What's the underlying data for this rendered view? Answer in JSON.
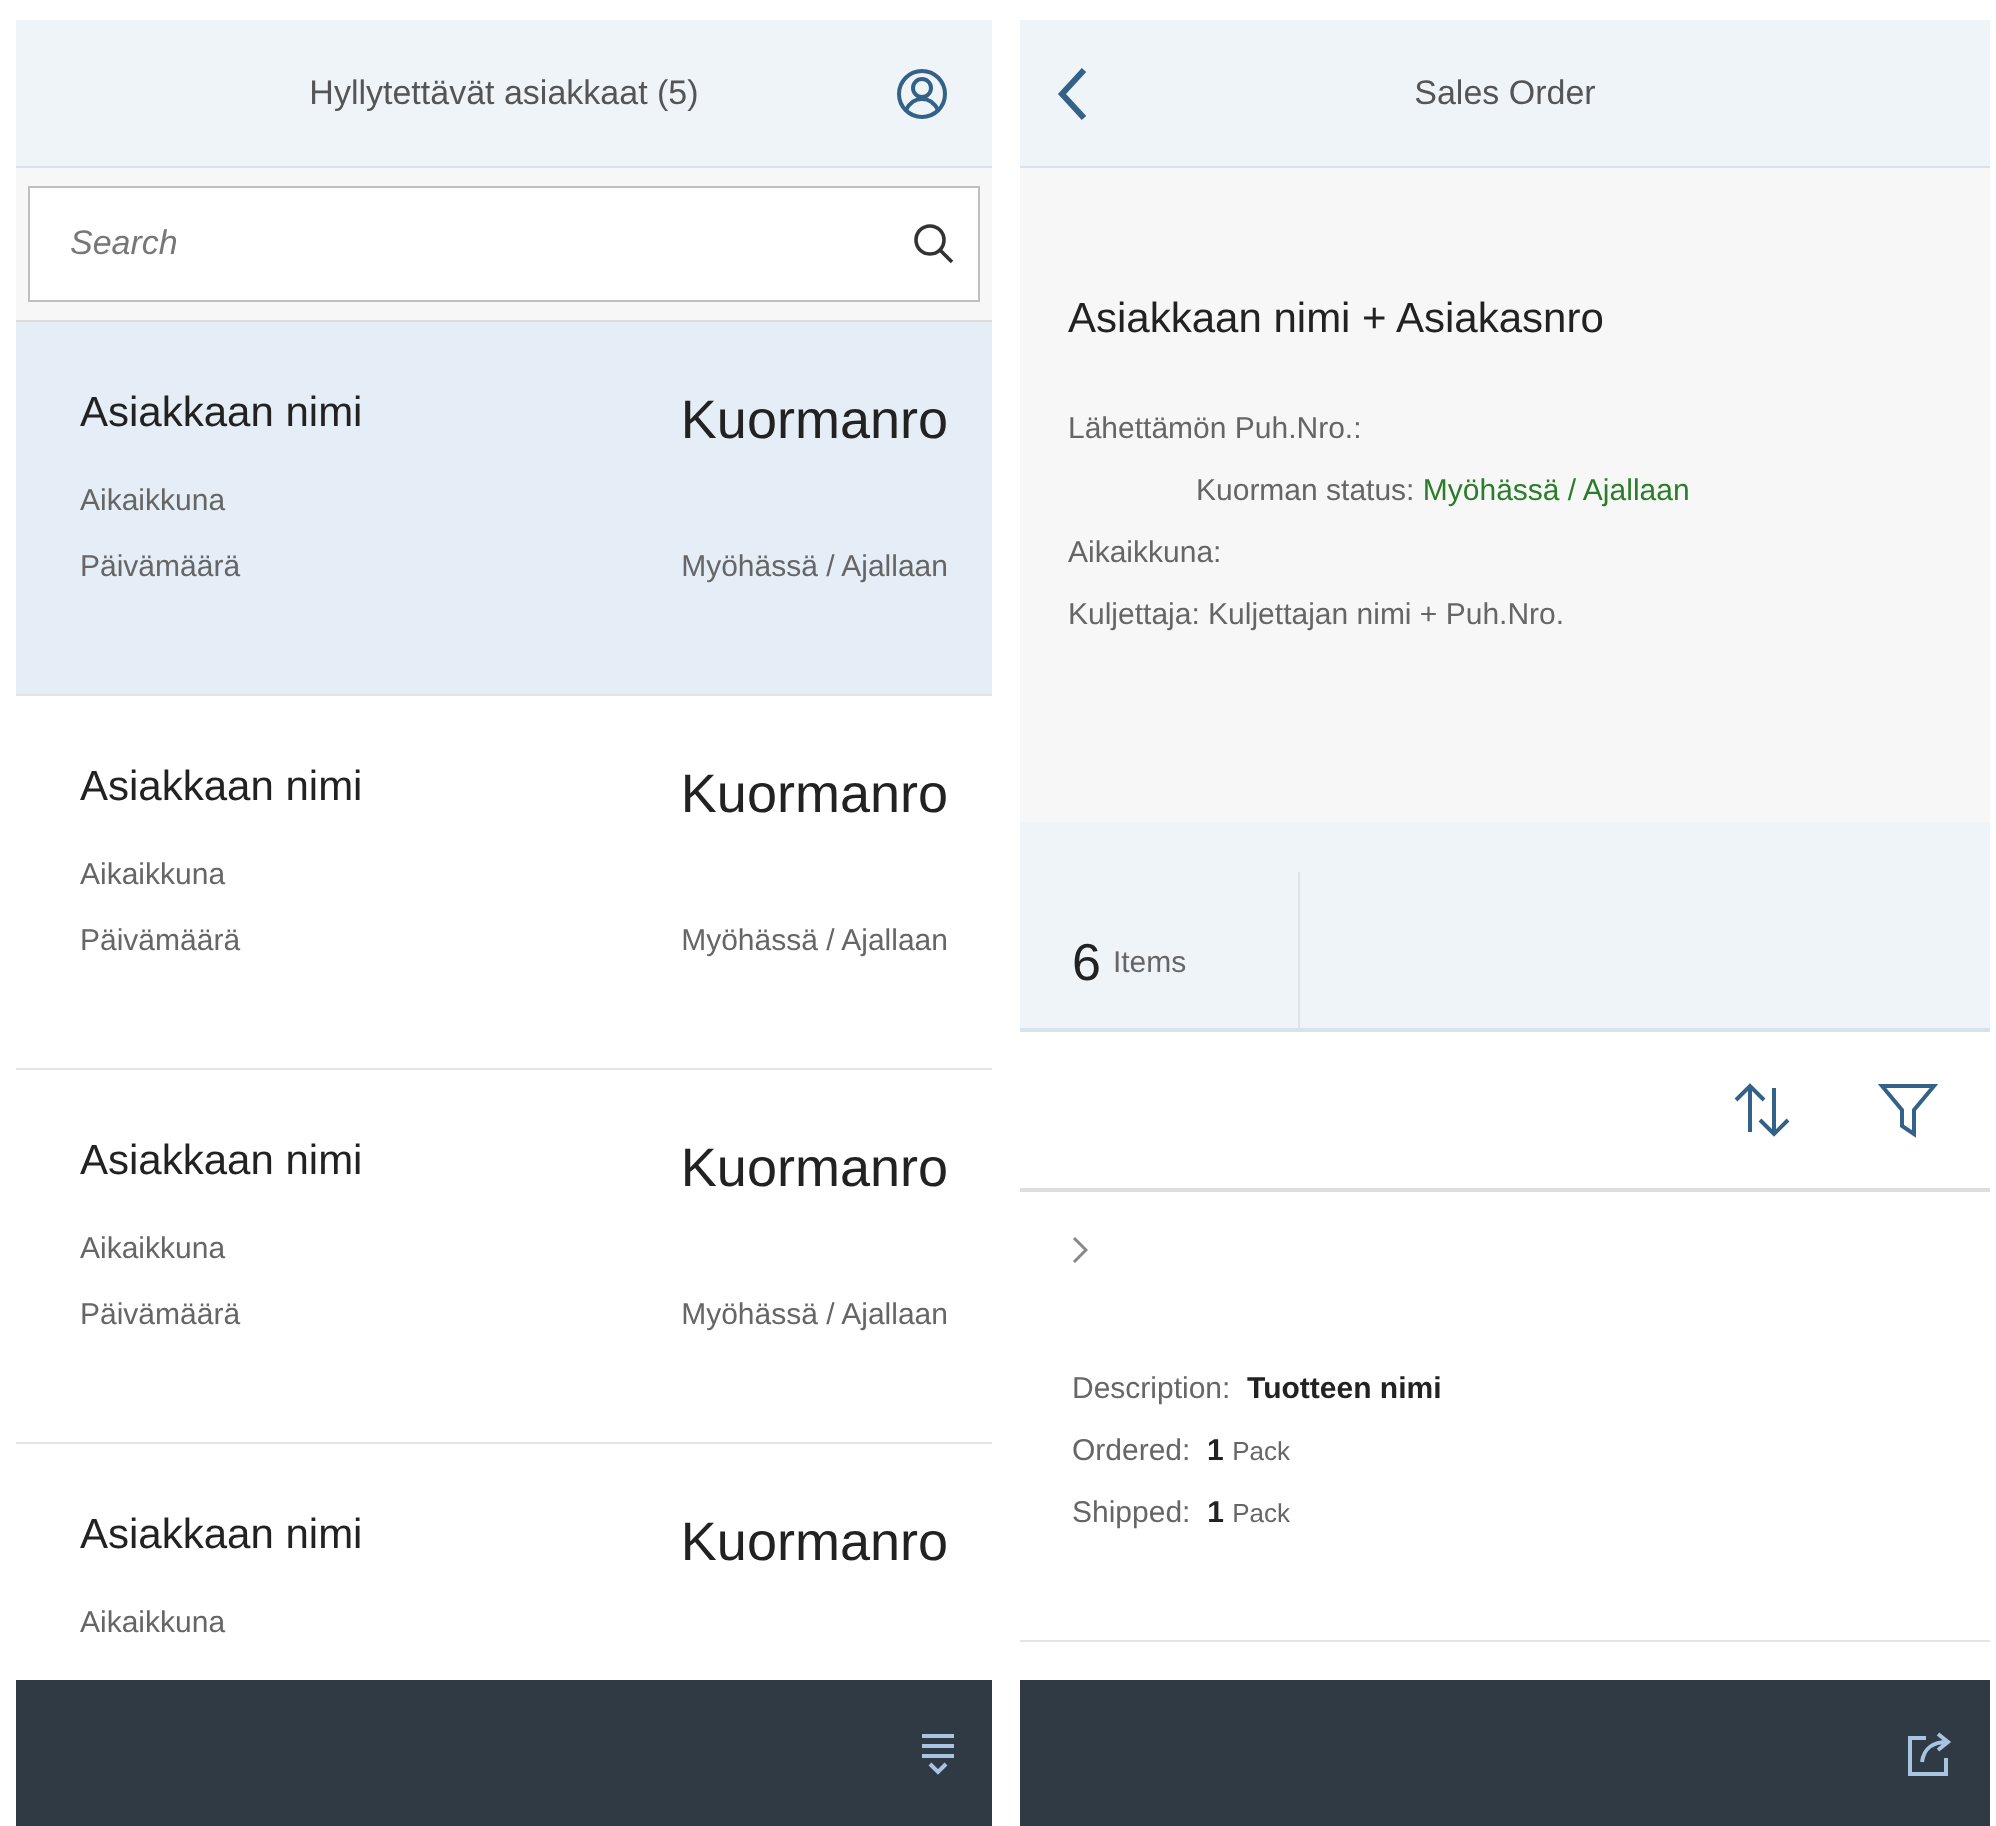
{
  "master": {
    "title": "Hyllytettävät asiakkaat (5)",
    "search": {
      "placeholder": "Search"
    },
    "items": [
      {
        "name": "Asiakkaan nimi",
        "number": "Kuormanro",
        "window": "Aikaikkuna",
        "date": "Päivämäärä",
        "status": "Myöhässä / Ajallaan",
        "selected": true
      },
      {
        "name": "Asiakkaan nimi",
        "number": "Kuormanro",
        "window": "Aikaikkuna",
        "date": "Päivämäärä",
        "status": "Myöhässä / Ajallaan",
        "selected": false
      },
      {
        "name": "Asiakkaan nimi",
        "number": "Kuormanro",
        "window": "Aikaikkuna",
        "date": "Päivämäärä",
        "status": "Myöhässä / Ajallaan",
        "selected": false
      },
      {
        "name": "Asiakkaan nimi",
        "number": "Kuormanro",
        "window": "Aikaikkuna",
        "selected": false
      }
    ]
  },
  "detail": {
    "title": "Sales Order",
    "heading": "Asiakkaan nimi + Asiakasnro",
    "sender_phone": "Lähettämön Puh.Nro.:",
    "status_label": "Kuorman status:",
    "status_value": "Myöhässä / Ajallaan",
    "time_window": "Aikaikkuna:",
    "driver_label": "Kuljettaja:",
    "driver_value": "Kuljettajan nimi + Puh.Nro.",
    "items_count": "6",
    "items_label": "Items",
    "line_items": [
      {
        "fields": [
          {
            "label": "Description:",
            "value": "Tuotteen nimi",
            "kind": "text"
          },
          {
            "label": "Ordered:",
            "value": "1",
            "unit": "Pack",
            "kind": "quantity"
          },
          {
            "label": "Shipped:",
            "value": "1",
            "unit": "Pack",
            "kind": "quantity"
          }
        ]
      }
    ]
  }
}
